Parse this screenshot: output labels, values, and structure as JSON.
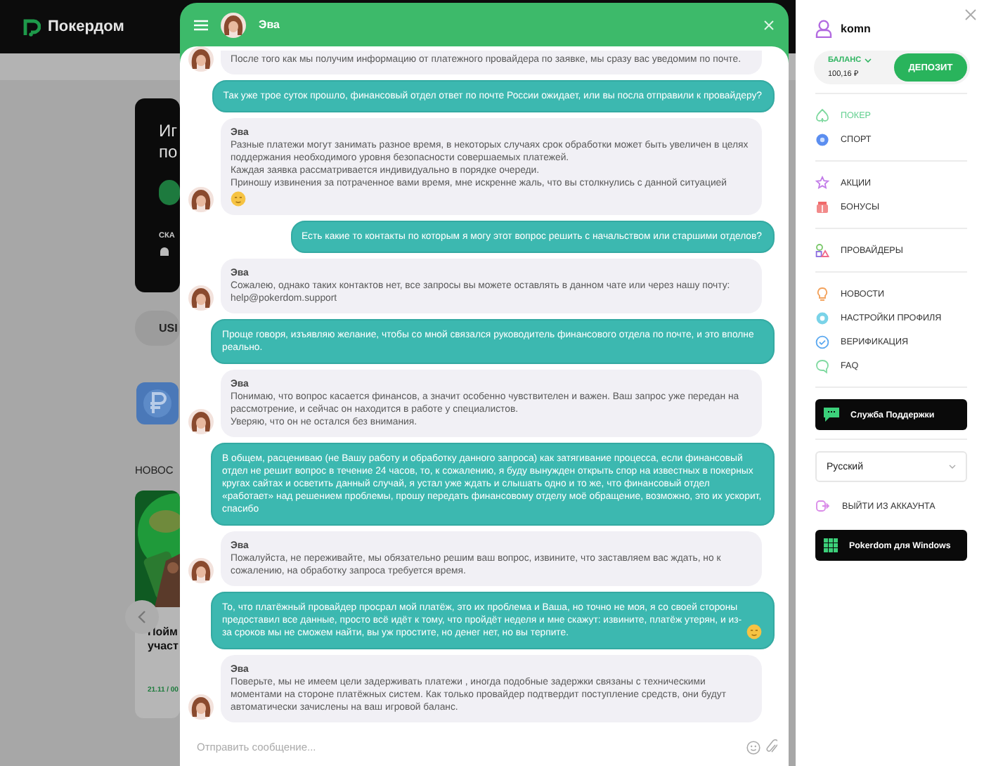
{
  "site": {
    "logo": "Покердом",
    "promo": {
      "line_1": "Иг",
      "line_2": "по",
      "download_label": "СКА"
    },
    "currency": "USI",
    "news_heading": "НОВОС",
    "news_card": {
      "title_line_1": "Пойм",
      "title_line_2": "участ",
      "date": "21.11 / 00"
    }
  },
  "chat": {
    "title": "Эва",
    "messages": [
      {
        "kind": "agent",
        "text": "После того как мы получим информацию от платежного провайдера по заявке, мы сразу вас уведомим по почте."
      },
      {
        "kind": "user",
        "text": "Так уже трое суток прошло, финансовый отдел ответ по почте России ожидает, или вы посла отправили к провайдеру?"
      },
      {
        "kind": "agent",
        "name": "Эва",
        "text": "Разные платежи могут занимать разное время, в некоторых случаях срок обработки может быть увеличен в целях поддержания необходимого уровня безопасности совершаемых платежей.\nКаждая заявка рассматривается индивидуально в порядке очереди.\nПриношу извинения за потраченное вами время, мне искренне жаль, что вы столкнулись с данной ситуацией",
        "emoji": true
      },
      {
        "kind": "user",
        "text": "Есть какие то контакты по которым я могу этот вопрос решить с начальством или старшими отделов?"
      },
      {
        "kind": "agent",
        "name": "Эва",
        "text": "Сожалею, однако таких контактов нет, все запросы вы можете оставлять  в данном чате или через нашу почту: help@pokerdom.support"
      },
      {
        "kind": "user",
        "text": "Проще говоря, изъявляю желание, чтобы со мной связался руководитель финансового отдела по почте, и это вполне реально."
      },
      {
        "kind": "agent",
        "name": "Эва",
        "text": "Понимаю, что вопрос касается финансов, а значит  особенно чувствителен и важен. Ваш запрос уже передан на рассмотрение, и сейчас он находится в работе у специалистов.\nУверяю, что он не остался без внимания."
      },
      {
        "kind": "user",
        "text": "В общем, расцениваю (не Вашу работу и обработку данного запроса) как затягивание процесса, если финансовый отдел не решит вопрос в течение 24 часов, то, к сожалению, я буду вынужден открыть спор на известных в покерных кругах сайтах и осветить данный случай, я устал уже ждать и слышать одно и то же, что финансовый отдел «работает» над решением проблемы, прошу передать финансовому отделу моё обращение, возможно, это их ускорит, спасибо"
      },
      {
        "kind": "agent",
        "name": "Эва",
        "text": "Пожалуйста, не переживайте, мы обязательно решим ваш вопрос, извините, что заставляем вас ждать, но к сожалению, на обработку запроса требуется время."
      },
      {
        "kind": "user",
        "text": "То, что платёжный провайдер просрал мой платёж, это их проблема и Ваша, но точно не моя, я со своей стороны предоставил все данные, просто всё идёт к тому, что пройдёт неделя и мне скажут: извините, платёж утерян, и из-за сроков мы не сможем найти, вы уж простите, но денег нет, но вы терпите.",
        "emoji": true
      },
      {
        "kind": "agent",
        "name": "Эва",
        "text": "Поверьте, мы не имеем цели задерживать платежи , иногда подобные задержки связаны с техническими моментами на стороне платёжных систем. Как только провайдер подтвердит поступление средств, они будут автоматически зачислены на ваш игровой баланс."
      }
    ],
    "input": {
      "placeholder": "Отправить сообщение..."
    }
  },
  "sidebar": {
    "username": "komn",
    "balance_label": "БАЛАНС",
    "balance": "100,16 ₽",
    "deposit_button": "ДЕПОЗИТ",
    "menu_groups": [
      {
        "items": [
          {
            "label": "ПОКЕР",
            "selected": true
          },
          {
            "label": "СПОРТ",
            "selected": false
          }
        ]
      },
      {
        "items": [
          {
            "label": "АКЦИИ",
            "selected": false
          },
          {
            "label": "БОНУСЫ",
            "selected": false
          }
        ]
      },
      {
        "items": [
          {
            "label": "ПРОВАЙДЕРЫ",
            "selected": false
          }
        ]
      },
      {
        "items": [
          {
            "label": "НОВОСТИ",
            "selected": false
          },
          {
            "label": "НАСТРОЙКИ ПРОФИЛЯ",
            "selected": false
          },
          {
            "label": "ВЕРИФИКАЦИЯ",
            "selected": false
          },
          {
            "label": "FAQ",
            "selected": false
          }
        ]
      }
    ],
    "support_button": "Служба Поддержки",
    "language": "Русский",
    "logout": "ВЫЙТИ ИЗ АККАУНТА",
    "windows_button": "Pokerdom для Windows"
  }
}
